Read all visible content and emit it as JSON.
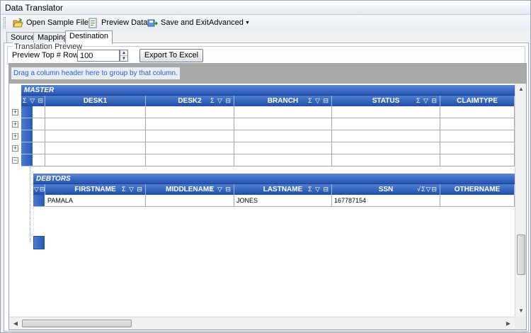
{
  "window": {
    "title": "Data Translator"
  },
  "toolbar": {
    "open_sample_file": "Open Sample File",
    "preview_data": "Preview Data",
    "save_and_exit": "Save and Exit",
    "advanced": "Advanced"
  },
  "tabs": [
    {
      "label": "Source"
    },
    {
      "label": "Mapping"
    },
    {
      "label": "Destination",
      "active": true
    }
  ],
  "preview": {
    "group_title": "Translation Preview",
    "rows_label": "Preview Top # Rows",
    "rows_value": "100",
    "export_label": "Export To Excel"
  },
  "grid": {
    "groupby_hint": "Drag a column header here to group by that column.",
    "master": {
      "band_label": "MASTER",
      "columns": [
        "DESK1",
        "DESK2",
        "BRANCH",
        "STATUS",
        "CLAIMTYPE"
      ],
      "row_count": 5
    },
    "debtors": {
      "band_label": "DEBTORS",
      "columns": [
        "FIRSTNAME",
        "MIDDLENAME",
        "LASTNAME",
        "SSN",
        "OTHERNAME"
      ],
      "rows": [
        {
          "FIRSTNAME": "PAMALA",
          "MIDDLENAME": "",
          "LASTNAME": "JONES",
          "SSN": "167787154",
          "OTHERNAME": ""
        }
      ]
    },
    "header_icons": "Σ ▽ ⊟"
  },
  "colors": {
    "header_blue": "#2554b3",
    "hint_text": "#2a63c8",
    "groupby_bg": "#a9a9a9"
  }
}
